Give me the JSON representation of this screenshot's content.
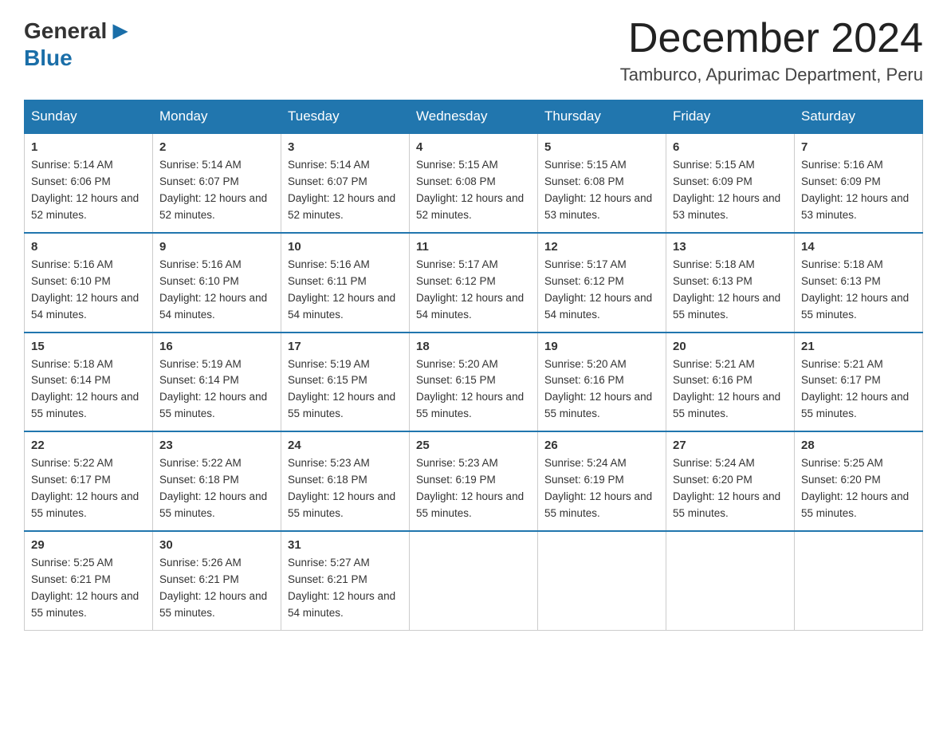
{
  "logo": {
    "general": "General",
    "blue": "Blue"
  },
  "title": "December 2024",
  "location": "Tamburco, Apurimac Department, Peru",
  "days_of_week": [
    "Sunday",
    "Monday",
    "Tuesday",
    "Wednesday",
    "Thursday",
    "Friday",
    "Saturday"
  ],
  "weeks": [
    [
      {
        "day": "1",
        "sunrise": "5:14 AM",
        "sunset": "6:06 PM",
        "daylight": "12 hours and 52 minutes."
      },
      {
        "day": "2",
        "sunrise": "5:14 AM",
        "sunset": "6:07 PM",
        "daylight": "12 hours and 52 minutes."
      },
      {
        "day": "3",
        "sunrise": "5:14 AM",
        "sunset": "6:07 PM",
        "daylight": "12 hours and 52 minutes."
      },
      {
        "day": "4",
        "sunrise": "5:15 AM",
        "sunset": "6:08 PM",
        "daylight": "12 hours and 52 minutes."
      },
      {
        "day": "5",
        "sunrise": "5:15 AM",
        "sunset": "6:08 PM",
        "daylight": "12 hours and 53 minutes."
      },
      {
        "day": "6",
        "sunrise": "5:15 AM",
        "sunset": "6:09 PM",
        "daylight": "12 hours and 53 minutes."
      },
      {
        "day": "7",
        "sunrise": "5:16 AM",
        "sunset": "6:09 PM",
        "daylight": "12 hours and 53 minutes."
      }
    ],
    [
      {
        "day": "8",
        "sunrise": "5:16 AM",
        "sunset": "6:10 PM",
        "daylight": "12 hours and 54 minutes."
      },
      {
        "day": "9",
        "sunrise": "5:16 AM",
        "sunset": "6:10 PM",
        "daylight": "12 hours and 54 minutes."
      },
      {
        "day": "10",
        "sunrise": "5:16 AM",
        "sunset": "6:11 PM",
        "daylight": "12 hours and 54 minutes."
      },
      {
        "day": "11",
        "sunrise": "5:17 AM",
        "sunset": "6:12 PM",
        "daylight": "12 hours and 54 minutes."
      },
      {
        "day": "12",
        "sunrise": "5:17 AM",
        "sunset": "6:12 PM",
        "daylight": "12 hours and 54 minutes."
      },
      {
        "day": "13",
        "sunrise": "5:18 AM",
        "sunset": "6:13 PM",
        "daylight": "12 hours and 55 minutes."
      },
      {
        "day": "14",
        "sunrise": "5:18 AM",
        "sunset": "6:13 PM",
        "daylight": "12 hours and 55 minutes."
      }
    ],
    [
      {
        "day": "15",
        "sunrise": "5:18 AM",
        "sunset": "6:14 PM",
        "daylight": "12 hours and 55 minutes."
      },
      {
        "day": "16",
        "sunrise": "5:19 AM",
        "sunset": "6:14 PM",
        "daylight": "12 hours and 55 minutes."
      },
      {
        "day": "17",
        "sunrise": "5:19 AM",
        "sunset": "6:15 PM",
        "daylight": "12 hours and 55 minutes."
      },
      {
        "day": "18",
        "sunrise": "5:20 AM",
        "sunset": "6:15 PM",
        "daylight": "12 hours and 55 minutes."
      },
      {
        "day": "19",
        "sunrise": "5:20 AM",
        "sunset": "6:16 PM",
        "daylight": "12 hours and 55 minutes."
      },
      {
        "day": "20",
        "sunrise": "5:21 AM",
        "sunset": "6:16 PM",
        "daylight": "12 hours and 55 minutes."
      },
      {
        "day": "21",
        "sunrise": "5:21 AM",
        "sunset": "6:17 PM",
        "daylight": "12 hours and 55 minutes."
      }
    ],
    [
      {
        "day": "22",
        "sunrise": "5:22 AM",
        "sunset": "6:17 PM",
        "daylight": "12 hours and 55 minutes."
      },
      {
        "day": "23",
        "sunrise": "5:22 AM",
        "sunset": "6:18 PM",
        "daylight": "12 hours and 55 minutes."
      },
      {
        "day": "24",
        "sunrise": "5:23 AM",
        "sunset": "6:18 PM",
        "daylight": "12 hours and 55 minutes."
      },
      {
        "day": "25",
        "sunrise": "5:23 AM",
        "sunset": "6:19 PM",
        "daylight": "12 hours and 55 minutes."
      },
      {
        "day": "26",
        "sunrise": "5:24 AM",
        "sunset": "6:19 PM",
        "daylight": "12 hours and 55 minutes."
      },
      {
        "day": "27",
        "sunrise": "5:24 AM",
        "sunset": "6:20 PM",
        "daylight": "12 hours and 55 minutes."
      },
      {
        "day": "28",
        "sunrise": "5:25 AM",
        "sunset": "6:20 PM",
        "daylight": "12 hours and 55 minutes."
      }
    ],
    [
      {
        "day": "29",
        "sunrise": "5:25 AM",
        "sunset": "6:21 PM",
        "daylight": "12 hours and 55 minutes."
      },
      {
        "day": "30",
        "sunrise": "5:26 AM",
        "sunset": "6:21 PM",
        "daylight": "12 hours and 55 minutes."
      },
      {
        "day": "31",
        "sunrise": "5:27 AM",
        "sunset": "6:21 PM",
        "daylight": "12 hours and 54 minutes."
      },
      null,
      null,
      null,
      null
    ]
  ]
}
